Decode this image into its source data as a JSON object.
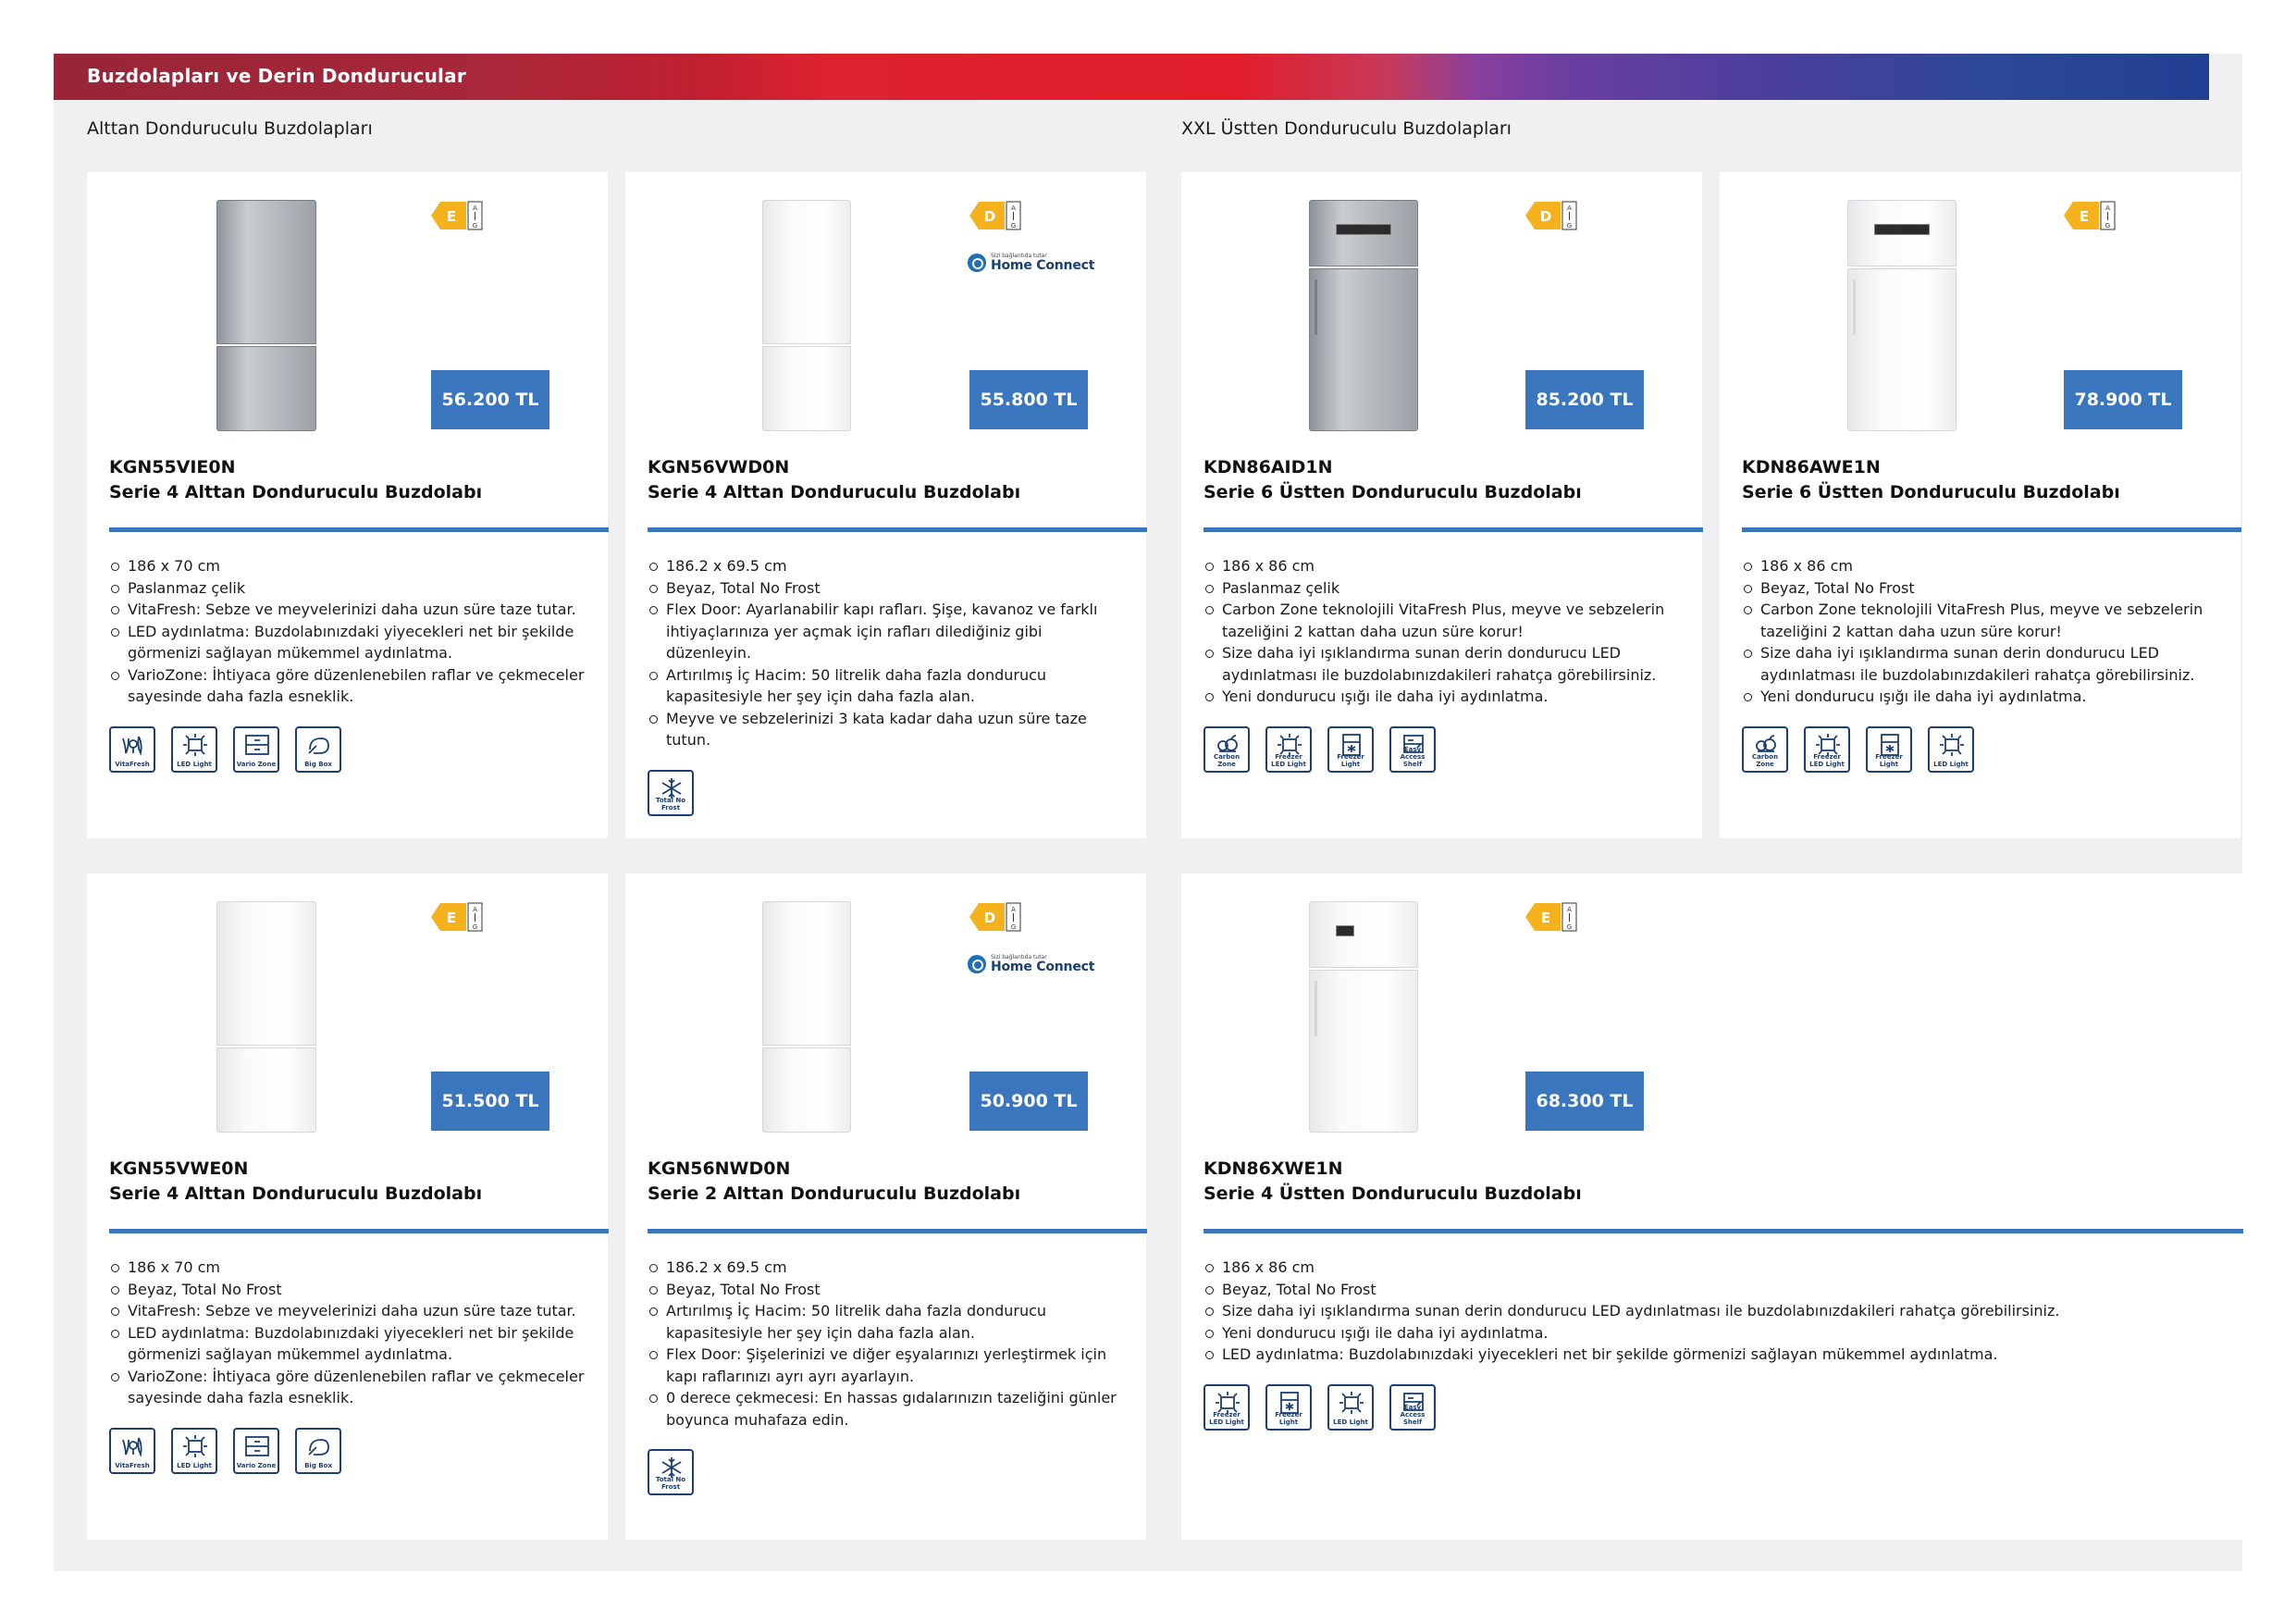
{
  "header": {
    "title": "Buzdolapları ve Derin Dondurucular"
  },
  "sections": {
    "left": "Alttan Donduruculu Buzdolapları",
    "right": "XXL Üstten Donduruculu Buzdolapları"
  },
  "colors": {
    "accent_blue": "#3a76bd",
    "icon_navy": "#1b3f74",
    "energy_yellow": "#f6b21c"
  },
  "products": [
    {
      "model": "KGN55VIE0N",
      "title": "Serie 4 Alttan Donduruculu Buzdolabı",
      "price": "56.200 TL",
      "energy": {
        "class": "E",
        "scale_top": "A",
        "scale_bottom": "G"
      },
      "home_connect": false,
      "finish": "steel",
      "features": [
        "186 x 70 cm",
        "Paslanmaz çelik",
        "VitaFresh: Sebze ve meyvelerinizi daha uzun süre taze tutar.",
        "LED aydınlatma: Buzdolabınızdaki yiyecekleri net bir şekilde görmenizi sağlayan mükemmel aydınlatma.",
        "VarioZone: İhtiyaca göre düzenlenebilen raflar ve çekmeceler sayesinde daha fazla esneklik."
      ],
      "icons": [
        {
          "name": "vitafresh-icon",
          "label": "VitaFresh"
        },
        {
          "name": "led-light-icon",
          "label": "LED Light"
        },
        {
          "name": "vario-zone-icon",
          "label": "Vario Zone"
        },
        {
          "name": "big-box-icon",
          "label": "Big Box"
        }
      ]
    },
    {
      "model": "KGN56VWD0N",
      "title": "Serie 4 Alttan Donduruculu Buzdolabı",
      "price": "55.800 TL",
      "energy": {
        "class": "D",
        "scale_top": "A",
        "scale_bottom": "G"
      },
      "home_connect": true,
      "finish": "white",
      "features": [
        "186.2 x 69.5 cm",
        "Beyaz, Total No Frost",
        "Flex Door: Ayarlanabilir kapı rafları. Şişe, kavanoz ve farklı ihtiyaçlarınıza yer açmak için rafları dilediğiniz gibi düzenleyin.",
        "Artırılmış İç Hacim: 50 litrelik daha fazla dondurucu kapasitesiyle her şey için daha fazla alan.",
        "Meyve ve sebzelerinizi 3 kata kadar daha uzun süre taze tutun."
      ],
      "icons": [
        {
          "name": "total-no-frost-icon",
          "label": "Total No Frost"
        }
      ]
    },
    {
      "model": "KDN86AID1N",
      "title": "Serie 6 Üstten Donduruculu Buzdolabı",
      "price": "85.200 TL",
      "energy": {
        "class": "D",
        "scale_top": "A",
        "scale_bottom": "G"
      },
      "home_connect": false,
      "finish": "steel-top",
      "features": [
        "186 x 86 cm",
        "Paslanmaz çelik",
        "Carbon Zone teknolojili VitaFresh Plus, meyve ve sebzelerin tazeliğini 2 kattan daha uzun süre korur!",
        "Size daha iyi ışıklandırma sunan derin dondurucu LED aydınlatması ile buzdolabınızdakileri rahatça görebilirsiniz.",
        "Yeni dondurucu ışığı ile daha iyi aydınlatma."
      ],
      "icons": [
        {
          "name": "carbon-zone-icon",
          "label": "Carbon Zone"
        },
        {
          "name": "freezer-led-light-icon",
          "label": "Freezer LED Light"
        },
        {
          "name": "freezer-light-icon",
          "label": "Freezer Light"
        },
        {
          "name": "easy-access-shelf-icon",
          "label": "Easy Access Shelf"
        }
      ]
    },
    {
      "model": "KDN86AWE1N",
      "title": "Serie 6 Üstten Donduruculu Buzdolabı",
      "price": "78.900 TL",
      "energy": {
        "class": "E",
        "scale_top": "A",
        "scale_bottom": "G"
      },
      "home_connect": false,
      "finish": "white-top",
      "features": [
        "186 x 86 cm",
        "Beyaz, Total No Frost",
        "Carbon Zone teknolojili VitaFresh Plus, meyve ve sebzelerin tazeliğini 2 kattan daha uzun süre korur!",
        "Size daha iyi ışıklandırma sunan derin dondurucu LED aydınlatması ile buzdolabınızdakileri rahatça görebilirsiniz.",
        "Yeni dondurucu ışığı ile daha iyi aydınlatma."
      ],
      "icons": [
        {
          "name": "carbon-zone-icon",
          "label": "Carbon Zone"
        },
        {
          "name": "freezer-led-light-icon",
          "label": "Freezer LED Light"
        },
        {
          "name": "freezer-light-icon",
          "label": "Freezer Light"
        },
        {
          "name": "led-light-icon",
          "label": "LED Light"
        }
      ]
    },
    {
      "model": "KGN55VWE0N",
      "title": "Serie 4 Alttan Donduruculu Buzdolabı",
      "price": "51.500 TL",
      "energy": {
        "class": "E",
        "scale_top": "A",
        "scale_bottom": "G"
      },
      "home_connect": false,
      "finish": "white",
      "features": [
        "186 x 70 cm",
        "Beyaz, Total No Frost",
        "VitaFresh: Sebze ve meyvelerinizi daha uzun süre taze tutar.",
        "LED aydınlatma: Buzdolabınızdaki yiyecekleri net bir şekilde görmenizi sağlayan mükemmel aydınlatma.",
        "VarioZone: İhtiyaca göre düzenlenebilen raflar ve çekmeceler sayesinde daha fazla esneklik."
      ],
      "icons": [
        {
          "name": "vitafresh-icon",
          "label": "VitaFresh"
        },
        {
          "name": "led-light-icon",
          "label": "LED Light"
        },
        {
          "name": "vario-zone-icon",
          "label": "Vario Zone"
        },
        {
          "name": "big-box-icon",
          "label": "Big Box"
        }
      ]
    },
    {
      "model": "KGN56NWD0N",
      "title": "Serie 2 Alttan Donduruculu Buzdolabı",
      "price": "50.900 TL",
      "energy": {
        "class": "D",
        "scale_top": "A",
        "scale_bottom": "G"
      },
      "home_connect": true,
      "finish": "white",
      "features": [
        "186.2 x 69.5 cm",
        "Beyaz, Total No Frost",
        "Artırılmış İç Hacim: 50 litrelik daha fazla dondurucu kapasitesiyle her şey için daha fazla alan.",
        "Flex Door: Şişelerinizi ve diğer eşyalarınızı yerleştirmek için kapı raflarınızı ayrı ayrı ayarlayın.",
        "0 derece çekmecesi: En hassas gıdalarınızın tazeliğini günler boyunca muhafaza edin."
      ],
      "icons": [
        {
          "name": "total-no-frost-icon",
          "label": "Total No Frost"
        }
      ]
    },
    {
      "model": "KDN86XWE1N",
      "title": "Serie 4 Üstten Donduruculu Buzdolabı",
      "price": "68.300 TL",
      "energy": {
        "class": "E",
        "scale_top": "A",
        "scale_bottom": "G"
      },
      "home_connect": false,
      "finish": "white-top-display",
      "features": [
        "186 x 86 cm",
        "Beyaz, Total No Frost",
        "Size daha iyi ışıklandırma sunan derin dondurucu LED aydınlatması ile buzdolabınızdakileri rahatça görebilirsiniz.",
        "Yeni dondurucu ışığı ile daha iyi aydınlatma.",
        "LED aydınlatma: Buzdolabınızdaki yiyecekleri net bir şekilde görmenizi sağlayan mükemmel aydınlatma."
      ],
      "icons": [
        {
          "name": "freezer-led-light-icon",
          "label": "Freezer LED Light"
        },
        {
          "name": "freezer-light-icon",
          "label": "Freezer Light"
        },
        {
          "name": "led-light-icon",
          "label": "LED Light"
        },
        {
          "name": "easy-access-shelf-icon",
          "label": "Easy Access Shelf"
        }
      ]
    }
  ],
  "home_connect": {
    "small": "Sizi bağlantıda tutar",
    "text": "Home Connect"
  }
}
